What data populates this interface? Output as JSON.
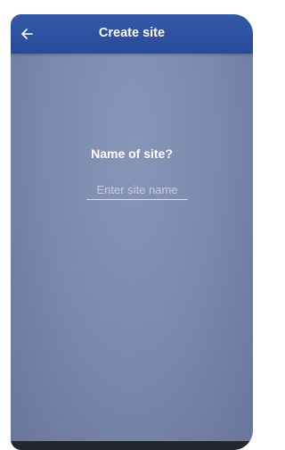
{
  "app_bar": {
    "title": "Create site",
    "back_icon": "arrow-left-icon"
  },
  "form": {
    "question": "Name of site?",
    "site_name_input": {
      "value": "",
      "placeholder": "Enter site name"
    }
  },
  "colors": {
    "app_bar": "#2f52a2",
    "background": "#7b8aae",
    "text": "#ffffff",
    "placeholder": "#c6cde4"
  }
}
